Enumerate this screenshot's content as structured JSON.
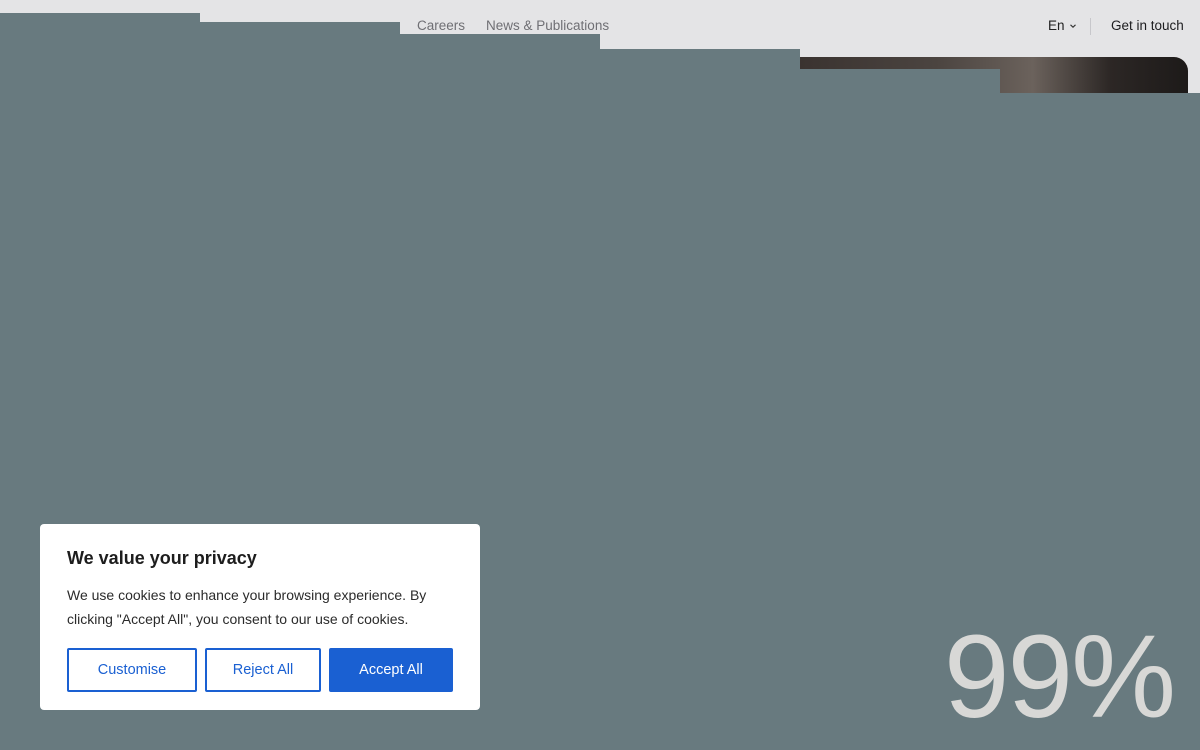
{
  "nav": {
    "links": [
      "Careers",
      "News & Publications"
    ],
    "language": "En",
    "cta_label": "Get in touch"
  },
  "hero": {
    "stat": "99%"
  },
  "cookie_banner": {
    "title": "We value your privacy",
    "text": "We use cookies to enhance your browsing experience. By clicking \"Accept All\", you consent to our use of cookies.",
    "buttons": {
      "customise": "Customise",
      "reject": "Reject All",
      "accept": "Accept All"
    }
  },
  "colors": {
    "overlay": "#687a7f",
    "nav_bg": "#e4e4e6",
    "accent": "#1a60d2"
  },
  "icons": {
    "language_toggle": "chevron-down-icon"
  }
}
